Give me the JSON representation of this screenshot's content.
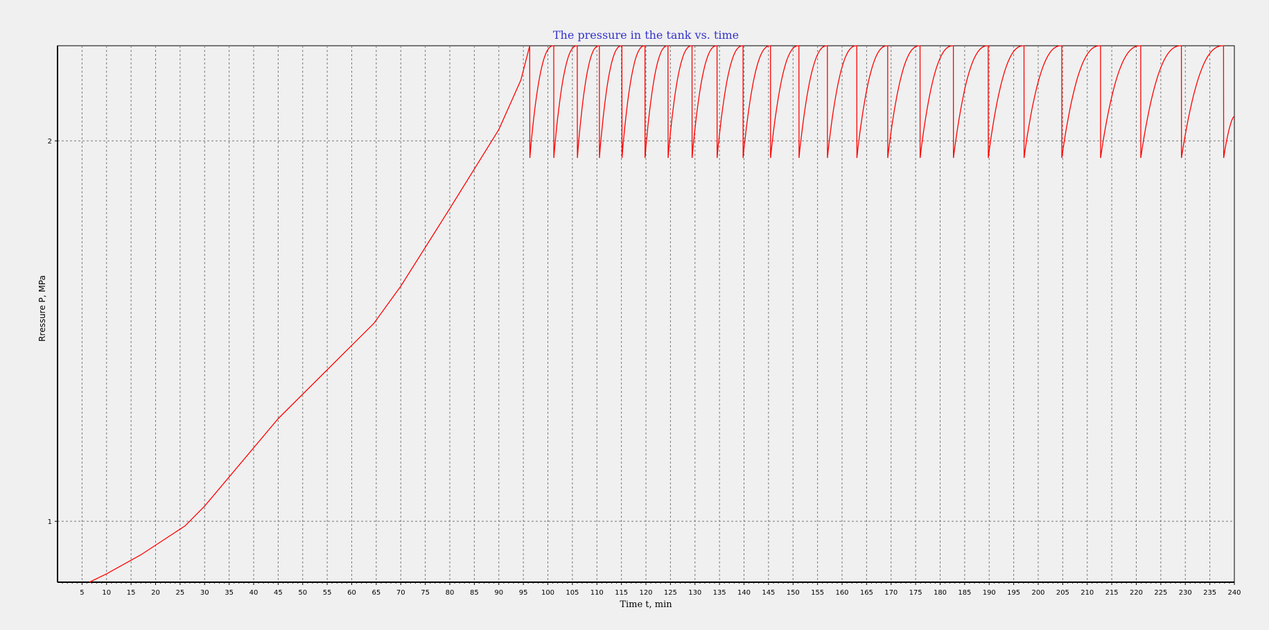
{
  "chart_data": {
    "type": "line",
    "title": "The pressure in the tank vs. time",
    "xlabel": "Time t, min",
    "ylabel": "Rressure P, MPa",
    "xlim": [
      0,
      240
    ],
    "ylim": [
      0.84,
      2.25
    ],
    "x_ticks": [
      5,
      10,
      15,
      20,
      25,
      30,
      35,
      40,
      45,
      50,
      55,
      60,
      65,
      70,
      75,
      80,
      85,
      90,
      95,
      100,
      105,
      110,
      115,
      120,
      125,
      130,
      135,
      140,
      145,
      150,
      155,
      160,
      165,
      170,
      175,
      180,
      185,
      190,
      195,
      200,
      205,
      210,
      215,
      220,
      225,
      230,
      235,
      240
    ],
    "y_ticks": [
      1,
      2
    ],
    "grid": true,
    "legend": "none",
    "line_color": "#ff0000",
    "series": [
      {
        "points": [
          [
            6.5,
            0.84
          ],
          [
            10,
            0.862
          ],
          [
            17,
            0.912
          ],
          [
            26,
            0.988
          ],
          [
            30,
            1.04
          ],
          [
            45,
            1.27
          ],
          [
            64.5,
            1.52
          ],
          [
            70,
            1.618
          ],
          [
            80,
            1.822
          ],
          [
            90,
            2.03
          ],
          [
            94.5,
            2.16
          ],
          [
            96.3,
            2.25
          ]
        ],
        "sawtooth": {
          "peak": 2.25,
          "drop": 1.955,
          "drops_at": [
            96.3,
            101.2,
            106.0,
            110.5,
            115.1,
            119.8,
            124.5,
            129.4,
            134.5,
            139.8,
            145.4,
            151.2,
            157.0,
            163.0,
            169.3,
            175.9,
            182.7,
            189.8,
            197.1,
            204.8,
            212.7,
            220.9,
            229.2,
            237.8
          ],
          "end": [
            240,
            2.065
          ]
        }
      }
    ]
  }
}
